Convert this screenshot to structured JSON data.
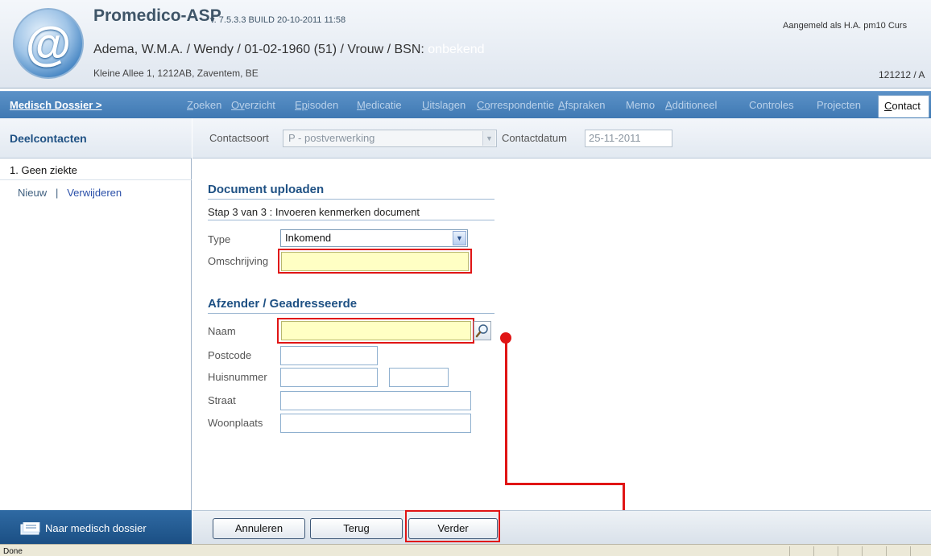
{
  "header": {
    "app_title": "Promedico-ASP",
    "version": "v. 7.5.3.3 BUILD 20-10-2011 11:58",
    "patient_main": "Adema, W.M.A. / Wendy / 01-02-1960 (51) / Vrouw / BSN: ",
    "patient_bsn": "onbekend",
    "address": "Kleine Allee 1, 1212AB, Zaventem, BE",
    "logged_in": "Aangemeld als H.A. pm10  Curs",
    "right_code": "121212 / A"
  },
  "nav": {
    "main": "Medisch Dossier >",
    "items": [
      {
        "first": "Z",
        "rest": "oeken"
      },
      {
        "first": "Ov",
        "rest": "erzicht"
      },
      {
        "first": "Ep",
        "rest": "isoden"
      },
      {
        "first": "M",
        "rest": "edicatie"
      },
      {
        "first": "U",
        "rest": "itslagen"
      },
      {
        "first": "Co",
        "rest": "rrespondentie"
      },
      {
        "first": "A",
        "rest": "fspraken"
      },
      {
        "first": "",
        "rest": "Memo"
      },
      {
        "first": "A",
        "rest": "dditioneel"
      },
      {
        "first": "",
        "rest": "Controles"
      },
      {
        "first": "",
        "rest": "Projecten"
      }
    ],
    "active_first": "C",
    "active_rest": "ontact"
  },
  "left": {
    "title": "Deelcontacten",
    "item": "1. Geen ziekte",
    "new": "Nieuw",
    "separator": "|",
    "delete": "Verwijderen",
    "bottom": "Naar medisch dossier"
  },
  "form_header": {
    "contactsoort_label": "Contactsoort",
    "contactsoort_value": "P - postverwerking",
    "contactdatum_label": "Contactdatum",
    "contactdatum_value": "25-11-2011"
  },
  "upload": {
    "title": "Document uploaden",
    "step": "Stap 3 van 3 : Invoeren kenmerken document",
    "type_label": "Type",
    "type_value": "Inkomend",
    "omschrijving_label": "Omschrijving"
  },
  "sender": {
    "title": "Afzender / Geadresseerde",
    "naam": "Naam",
    "postcode": "Postcode",
    "huisnummer": "Huisnummer",
    "straat": "Straat",
    "woonplaats": "Woonplaats"
  },
  "buttons": {
    "cancel": "Annuleren",
    "back": "Terug",
    "next": "Verder"
  },
  "status": "Done"
}
